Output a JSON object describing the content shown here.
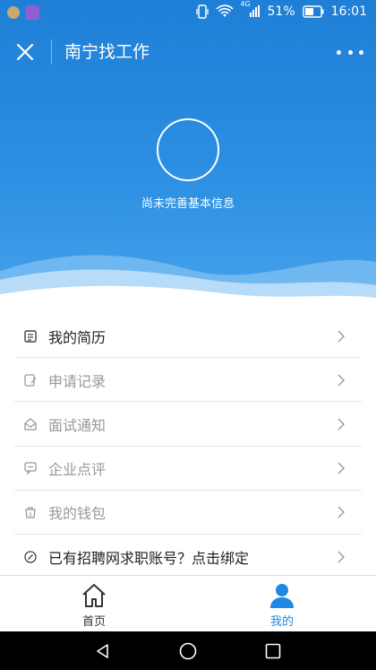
{
  "status_bar": {
    "network": "4G",
    "battery": "51%",
    "time": "16:01"
  },
  "header": {
    "title": "南宁找工作"
  },
  "profile": {
    "status_text": "尚未完善基本信息"
  },
  "menu": {
    "items": [
      {
        "label": "我的简历",
        "icon": "resume-icon"
      },
      {
        "label": "申请记录",
        "icon": "edit-record-icon"
      },
      {
        "label": "面试通知",
        "icon": "mail-open-icon"
      },
      {
        "label": "企业点评",
        "icon": "comment-icon"
      },
      {
        "label": "我的钱包",
        "icon": "wallet-icon"
      },
      {
        "label": "已有招聘网求职账号？点击绑定",
        "icon": "link-icon"
      }
    ]
  },
  "tabs": [
    {
      "label": "首页",
      "icon": "home-icon"
    },
    {
      "label": "我的",
      "icon": "user-icon"
    }
  ],
  "colors": {
    "brand_blue": "#1e88e5",
    "hero_top": "#1e7fd6",
    "hero_bottom": "#46a2ec"
  }
}
